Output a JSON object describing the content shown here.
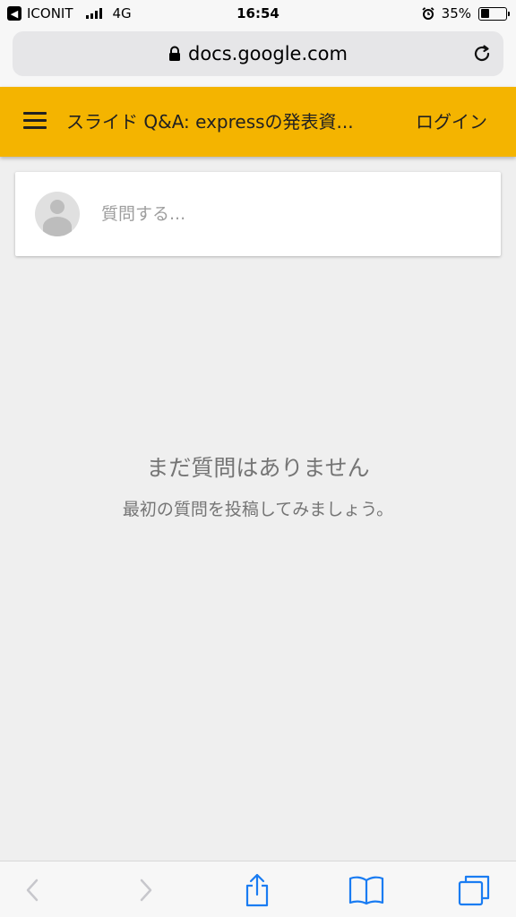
{
  "status_bar": {
    "carrier": "ICONIT",
    "network": "4G",
    "time": "16:54",
    "battery_percent": "35%",
    "battery_level": 0.35,
    "alarm_icon": "alarm-clock-icon"
  },
  "browser": {
    "url": "docs.google.com",
    "lock_icon": "lock-icon",
    "reload_icon": "reload-icon"
  },
  "header": {
    "title": "スライド Q&A: expressの発表資...",
    "login_label": "ログイン",
    "background_color": "#f4b400"
  },
  "question": {
    "placeholder": "質問する..."
  },
  "empty_state": {
    "title": "まだ質問はありません",
    "subtitle": "最初の質問を投稿してみましょう。"
  },
  "toolbar": {
    "icons": [
      "back-arrow-icon",
      "forward-arrow-icon",
      "share-icon",
      "bookmarks-icon",
      "tabs-icon"
    ],
    "accent_color": "#1a7cf2"
  }
}
